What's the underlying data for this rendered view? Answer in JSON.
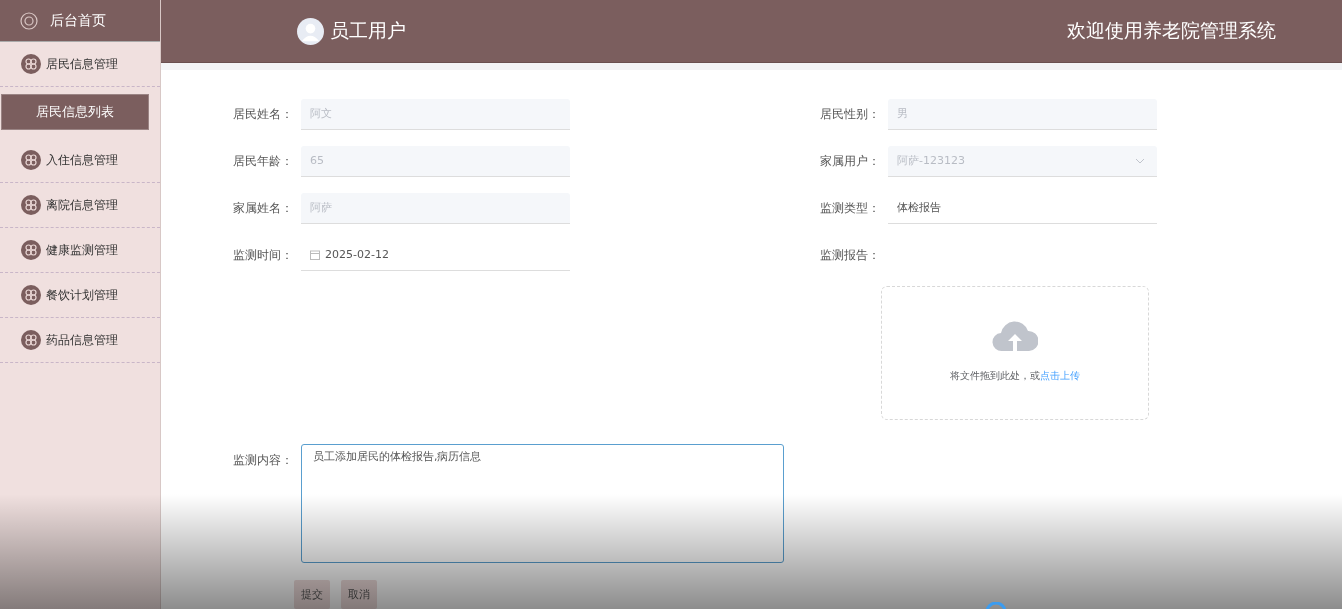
{
  "sidebar": {
    "home": "后台首页",
    "items": [
      {
        "label": "居民信息管理",
        "children": [
          {
            "label": "居民信息列表",
            "selected": true
          }
        ]
      },
      {
        "label": "入住信息管理"
      },
      {
        "label": "离院信息管理"
      },
      {
        "label": "健康监测管理"
      },
      {
        "label": "餐饮计划管理"
      },
      {
        "label": "药品信息管理"
      }
    ]
  },
  "header": {
    "user": "员工用户",
    "title": "欢迎使用养老院管理系统"
  },
  "form": {
    "left": [
      {
        "kind": "text",
        "label": "居民姓名：",
        "value": "阿文",
        "disabled": true
      },
      {
        "kind": "text",
        "label": "居民年龄：",
        "value": "65",
        "disabled": true
      },
      {
        "kind": "text",
        "label": "家属姓名：",
        "value": "阿萨",
        "disabled": true
      },
      {
        "kind": "date",
        "label": "监测时间：",
        "value": "2025-02-12",
        "disabled": false
      }
    ],
    "right": [
      {
        "kind": "text",
        "label": "居民性别：",
        "value": "男",
        "disabled": true
      },
      {
        "kind": "select",
        "label": "家属用户：",
        "value": "阿萨-123123",
        "disabled": true
      },
      {
        "kind": "text",
        "label": "监测类型：",
        "value": "体检报告",
        "disabled": false
      }
    ],
    "upload": {
      "label": "监测报告：",
      "hint": "将文件拖到此处，或",
      "link": "点击上传"
    },
    "content": {
      "label": "监测内容：",
      "value": "员工添加居民的体检报告,病历信息"
    },
    "buttons": [
      "提交",
      "取消"
    ]
  }
}
